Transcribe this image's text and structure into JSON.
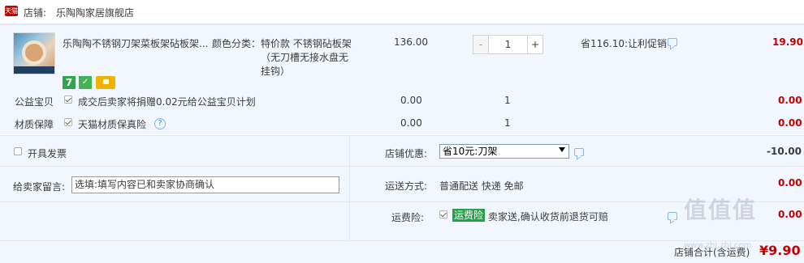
{
  "shop": {
    "badge": "天猫",
    "label": "店铺:",
    "name": "乐陶陶家居旗舰店"
  },
  "item": {
    "title": "乐陶陶不锈钢刀架菜板架砧板架...",
    "sku_label": "颜色分类：",
    "sku_value": "特价款 不锈钢砧板架（无刀槽无接水盘无挂钩）",
    "unit_price": "136.00",
    "quantity": "1",
    "qty_minus": "-",
    "qty_plus": "+",
    "promo": "省116.10:让利促销",
    "total": "19.90",
    "badge_seven": "7",
    "badge_shield": "✓"
  },
  "services": [
    {
      "name": "公益宝贝",
      "desc": "成交后卖家将捐赠0.02元给公益宝贝计划",
      "price": "0.00",
      "qty": "1",
      "total": "0.00"
    },
    {
      "name": "材质保障",
      "desc": "天猫材质保真险",
      "price": "0.00",
      "qty": "1",
      "total": "0.00",
      "help": "?"
    }
  ],
  "invoice": {
    "label": "开具发票"
  },
  "discount": {
    "label": "店铺优惠:",
    "selected": "省10元:刀架",
    "amount": "-10.00"
  },
  "message": {
    "label": "给卖家留言:",
    "placeholder": "选填:填写内容已和卖家协商确认"
  },
  "shipping": {
    "label": "运送方式:",
    "value": "普通配送 快递 免邮",
    "fee": "0.00"
  },
  "insurance": {
    "label": "运费险:",
    "tag": "运费险",
    "desc": "卖家送,确认收货前退货可赔",
    "fee": "0.00"
  },
  "shop_total": {
    "label": "店铺合计(含运费)",
    "value": "¥9.90"
  },
  "watermark": {
    "text": "值值值",
    "sub": "www.zhi.zhi.com"
  },
  "colors": {
    "price_red": "#c40000",
    "row_bg": "#f2f7ff",
    "tmall_red": "#c40000",
    "green_tag": "#22a34a"
  }
}
